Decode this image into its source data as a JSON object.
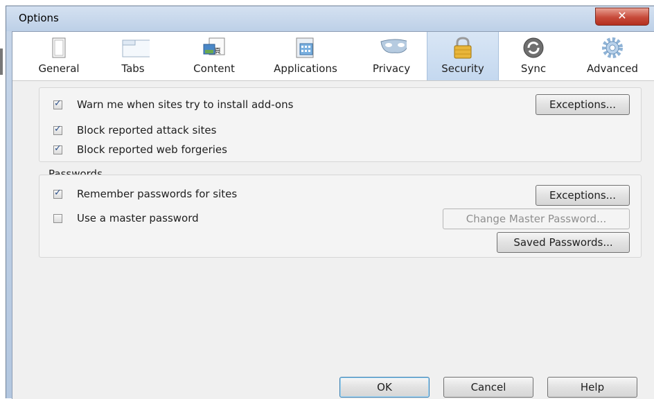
{
  "window": {
    "title": "Options",
    "close_glyph": "✕"
  },
  "toolbar": {
    "tabs": [
      {
        "label": "General",
        "icon": "general-icon"
      },
      {
        "label": "Tabs",
        "icon": "tabs-icon"
      },
      {
        "label": "Content",
        "icon": "content-icon"
      },
      {
        "label": "Applications",
        "icon": "applications-icon"
      },
      {
        "label": "Privacy",
        "icon": "privacy-mask-icon"
      },
      {
        "label": "Security",
        "icon": "padlock-icon",
        "selected": true
      },
      {
        "label": "Sync",
        "icon": "sync-icon"
      },
      {
        "label": "Advanced",
        "icon": "gear-icon"
      }
    ]
  },
  "security": {
    "warn_addons": {
      "label": "Warn me when sites try to install add-ons",
      "checked": true
    },
    "exceptions_label": "Exceptions...",
    "block_attack": {
      "label": "Block reported attack sites",
      "checked": true
    },
    "block_forgeries": {
      "label": "Block reported web forgeries",
      "checked": true
    }
  },
  "passwords": {
    "group_label": "Passwords",
    "remember": {
      "label": "Remember passwords for sites",
      "checked": true
    },
    "exceptions_label": "Exceptions...",
    "master": {
      "label": "Use a master password",
      "checked": false
    },
    "change_master_label": "Change Master Password...",
    "saved_label": "Saved Passwords..."
  },
  "footer": {
    "ok": "OK",
    "cancel": "Cancel",
    "help": "Help"
  },
  "colors": {
    "selected_tab": "#c4d8ef",
    "close": "#c74a3a",
    "check": "#2a4e88"
  }
}
